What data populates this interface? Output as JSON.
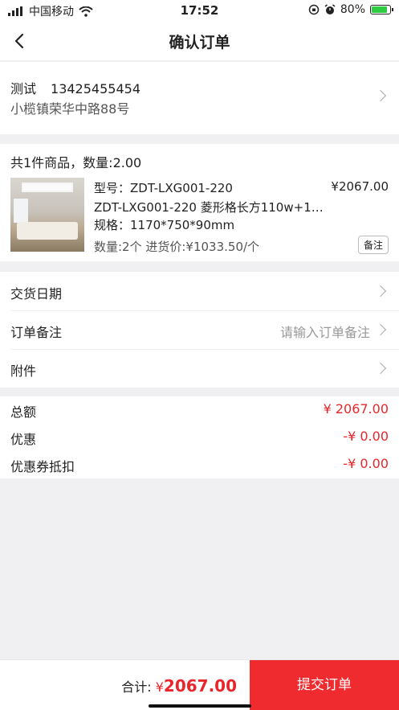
{
  "status_bar": {
    "carrier": "中国移动",
    "time": "17:52",
    "battery": "80%",
    "battery_level": 0.8
  },
  "nav": {
    "title": "确认订单"
  },
  "address": {
    "name": "测试",
    "phone": "13425455454",
    "detail": "小榄镇荣华中路88号"
  },
  "goods": {
    "summary": "共1件商品，数量:2.00",
    "items": [
      {
        "model": "型号：ZDT-LXG001-220",
        "price": "¥2067.00",
        "name": "ZDT-LXG001-220 菱形格长方110w+11...",
        "spec": "规格：1170*750*90mm",
        "qty": "数量:2个 进货价:¥1033.50/个",
        "remark_label": "备注"
      }
    ]
  },
  "options": {
    "delivery_date": {
      "label": "交货日期"
    },
    "order_note": {
      "label": "订单备注",
      "placeholder": "请输入订单备注"
    },
    "attachment": {
      "label": "附件"
    }
  },
  "summary": {
    "total_label": "总额",
    "total_value": "¥ 2067.00",
    "discount_label": "优惠",
    "discount_value": "-¥ 0.00",
    "coupon_label": "优惠券抵扣",
    "coupon_value": "-¥ 0.00"
  },
  "footer": {
    "total_prefix": "合计:",
    "currency": "¥",
    "total_amount": "2067.00",
    "submit_label": "提交订单"
  },
  "colors": {
    "accent": "#ef2b30",
    "price_red": "#e8262b",
    "background": "#f0f0f2"
  }
}
